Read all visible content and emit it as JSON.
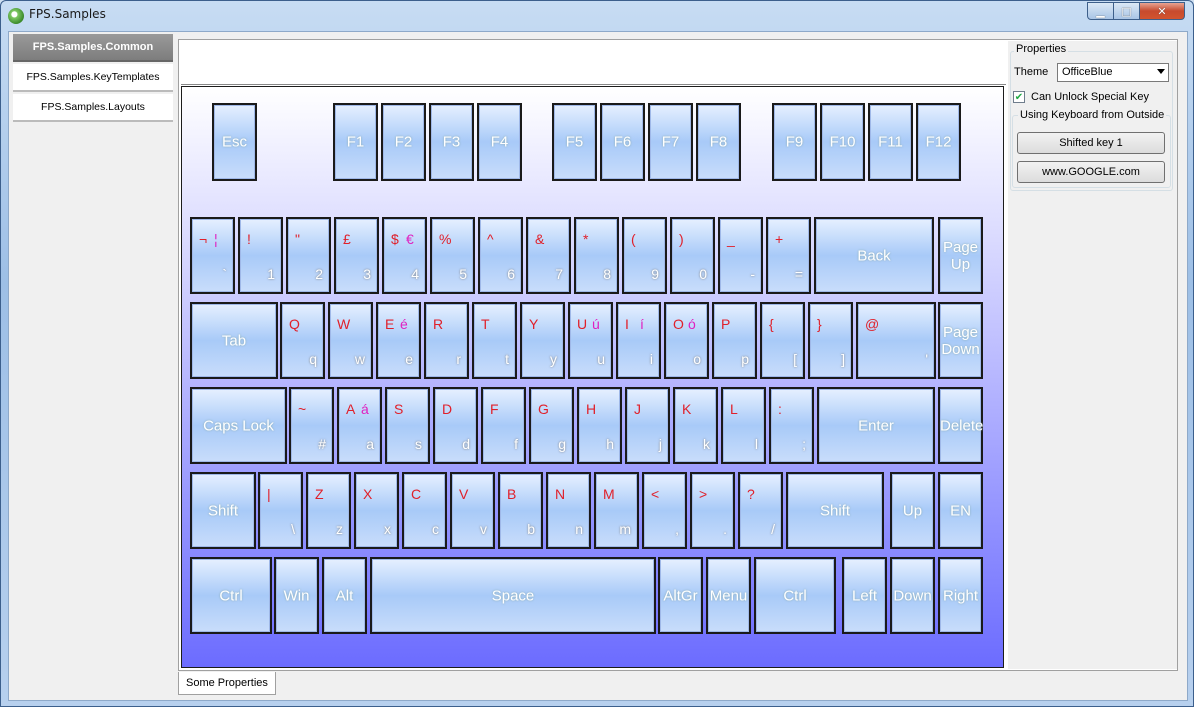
{
  "window": {
    "title": "FPS.Samples",
    "min_glyph": "▁",
    "max_glyph": "□",
    "close_glyph": "✕"
  },
  "nav": {
    "items": [
      "FPS.Samples.Common",
      "FPS.Samples.KeyTemplates",
      "FPS.Samples.Layouts"
    ]
  },
  "keyboard": {
    "rows": [
      [
        {
          "label": "Esc"
        },
        {
          "label": "F1"
        },
        {
          "label": "F2"
        },
        {
          "label": "F3"
        },
        {
          "label": "F4"
        },
        {
          "label": "F5"
        },
        {
          "label": "F6"
        },
        {
          "label": "F7"
        },
        {
          "label": "F8"
        },
        {
          "label": "F9"
        },
        {
          "label": "F10"
        },
        {
          "label": "F11"
        },
        {
          "label": "F12"
        }
      ],
      [
        {
          "shift": "¬",
          "alt": "¦",
          "base": "`"
        },
        {
          "shift": "!",
          "base": "1"
        },
        {
          "shift": "\"",
          "base": "2"
        },
        {
          "shift": "£",
          "base": "3"
        },
        {
          "shift": "$",
          "alt": "€",
          "base": "4"
        },
        {
          "shift": "%",
          "base": "5"
        },
        {
          "shift": "^",
          "base": "6"
        },
        {
          "shift": "&",
          "base": "7"
        },
        {
          "shift": "*",
          "base": "8"
        },
        {
          "shift": "(",
          "base": "9"
        },
        {
          "shift": ")",
          "base": "0"
        },
        {
          "shift": "_",
          "base": "-"
        },
        {
          "shift": "+",
          "base": "="
        },
        {
          "label": "Back"
        },
        {
          "label": "Page Up"
        }
      ],
      [
        {
          "label": "Tab"
        },
        {
          "shift": "Q",
          "base": "q"
        },
        {
          "shift": "W",
          "base": "w"
        },
        {
          "shift": "E",
          "alt": "é",
          "base": "e"
        },
        {
          "shift": "R",
          "base": "r"
        },
        {
          "shift": "T",
          "base": "t"
        },
        {
          "shift": "Y",
          "base": "y"
        },
        {
          "shift": "U",
          "alt": "ú",
          "base": "u"
        },
        {
          "shift": "I",
          "alt": "í",
          "base": "i"
        },
        {
          "shift": "O",
          "alt": "ó",
          "base": "o"
        },
        {
          "shift": "P",
          "base": "p"
        },
        {
          "shift": "{",
          "base": "["
        },
        {
          "shift": "}",
          "base": "]"
        },
        {
          "shift": "@",
          "base": "'"
        },
        {
          "label": "Page Down"
        }
      ],
      [
        {
          "label": "Caps Lock"
        },
        {
          "shift": "~",
          "base": "#"
        },
        {
          "shift": "A",
          "alt": "á",
          "base": "a"
        },
        {
          "shift": "S",
          "base": "s"
        },
        {
          "shift": "D",
          "base": "d"
        },
        {
          "shift": "F",
          "base": "f"
        },
        {
          "shift": "G",
          "base": "g"
        },
        {
          "shift": "H",
          "base": "h"
        },
        {
          "shift": "J",
          "base": "j"
        },
        {
          "shift": "K",
          "base": "k"
        },
        {
          "shift": "L",
          "base": "l"
        },
        {
          "shift": ":",
          "base": ";"
        },
        {
          "label": "Enter"
        },
        {
          "label": "Delete"
        }
      ],
      [
        {
          "label": "Shift"
        },
        {
          "shift": "|",
          "base": "\\"
        },
        {
          "shift": "Z",
          "base": "z"
        },
        {
          "shift": "X",
          "base": "x"
        },
        {
          "shift": "C",
          "base": "c"
        },
        {
          "shift": "V",
          "base": "v"
        },
        {
          "shift": "B",
          "base": "b"
        },
        {
          "shift": "N",
          "base": "n"
        },
        {
          "shift": "M",
          "base": "m"
        },
        {
          "shift": "<",
          "base": ","
        },
        {
          "shift": ">",
          "base": "."
        },
        {
          "shift": "?",
          "base": "/"
        },
        {
          "label": "Shift"
        },
        {
          "label": "Up"
        },
        {
          "label": "EN"
        }
      ],
      [
        {
          "label": "Ctrl"
        },
        {
          "label": "Win"
        },
        {
          "label": "Alt"
        },
        {
          "label": "Space"
        },
        {
          "label": "AltGr"
        },
        {
          "label": "Menu"
        },
        {
          "label": "Ctrl"
        },
        {
          "label": "Left"
        },
        {
          "label": "Down"
        },
        {
          "label": "Right"
        }
      ]
    ]
  },
  "properties": {
    "title": "Properties",
    "theme_label": "Theme",
    "theme_value": "OfficeBlue",
    "checkbox_label": "Can Unlock Special Key",
    "checkbox_mark": "✔",
    "group_title": "Using Keyboard from Outside",
    "button1": "Shifted key 1",
    "button2": "www.GOOGLE.com"
  },
  "bottom_tab": "Some Properties"
}
